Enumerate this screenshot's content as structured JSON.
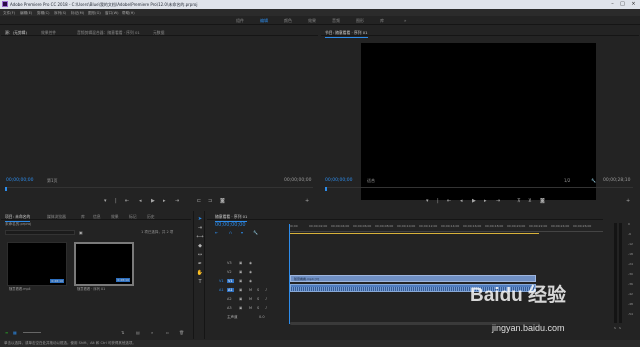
{
  "window": {
    "title": "Adobe Premiere Pro CC 2018 - C:\\Users\\Blue\\我的文档\\Adobe\\Premiere Pro\\12.0\\未命名的.prproj",
    "controls": [
      "–",
      "□",
      "×"
    ]
  },
  "menu": [
    "文件(F)",
    "编辑(E)",
    "剪辑(C)",
    "序列(S)",
    "标记(M)",
    "图形(G)",
    "窗口(W)",
    "帮助(H)"
  ],
  "workspaces": [
    {
      "label": "组件",
      "active": false
    },
    {
      "label": "编辑",
      "active": true
    },
    {
      "label": "颜色",
      "active": false
    },
    {
      "label": "效果",
      "active": false
    },
    {
      "label": "音频",
      "active": false
    },
    {
      "label": "图形",
      "active": false
    },
    {
      "label": "库",
      "active": false
    },
    {
      "label": "»",
      "active": false
    }
  ],
  "source_panel": {
    "tabs": [
      {
        "label": "源：(无剪辑)",
        "active": true
      },
      {
        "label": "效果控件",
        "active": false
      },
      {
        "label": "音频剪辑混合器：随意看看 · 序列 01",
        "active": false
      },
      {
        "label": "元数据",
        "active": false
      }
    ],
    "timecode_left": "00;00;00;00",
    "page": "第1页",
    "timecode_right": "00;00;00;00"
  },
  "program_panel": {
    "tab_label": "节目: 随意看看 · 序列 01",
    "timecode_left": "00;00;00;00",
    "fit": "适合",
    "ratio": "1/2",
    "timecode_right": "00;00;28;10"
  },
  "project_panel": {
    "tabs": [
      {
        "label": "项目: 未命名的",
        "active": true
      },
      {
        "label": "媒体浏览器",
        "active": false
      },
      {
        "label": "库",
        "active": false
      },
      {
        "label": "信息",
        "active": false
      },
      {
        "label": "效果",
        "active": false
      },
      {
        "label": "标记",
        "active": false
      },
      {
        "label": "历史",
        "active": false
      }
    ],
    "file_name": "未命名的.prproj",
    "search_placeholder": "",
    "selection_info": "1 项已选择，共 2 项",
    "items": [
      {
        "name": "随意看看.mp4",
        "duration": "0:28:10",
        "selected": false
      },
      {
        "name": "随意看看 · 序列 01",
        "duration": "0:28:10",
        "selected": true
      }
    ]
  },
  "timeline": {
    "tab_label": "随意看看 · 序列 01",
    "timecode": "00;00;00;00",
    "ruler_ticks": [
      "00;00",
      "00;00;02;00",
      "00;00;04;00",
      "00;00;06;00",
      "00;00;08;00",
      "00;00;10;00",
      "00;00;12;00",
      "00;00;14;00",
      "00;00;16;00",
      "00;00;18;00",
      "00;00;20;00",
      "00;00;22;00",
      "00;00;24;00",
      "00;00;26;00"
    ],
    "tracks": [
      {
        "name": "V3",
        "kind": "video"
      },
      {
        "name": "V2",
        "kind": "video"
      },
      {
        "name": "V1",
        "kind": "video"
      },
      {
        "name": "A1",
        "kind": "audio"
      },
      {
        "name": "A2",
        "kind": "audio"
      },
      {
        "name": "A3",
        "kind": "audio"
      }
    ],
    "master": {
      "label": "主声道",
      "value": "0.0"
    },
    "video_clip_label": "随意看看.mp4 [V]",
    "audio_clip_label": ""
  },
  "meters": {
    "scale": [
      "0",
      "-6",
      "-12",
      "-18",
      "-24",
      "-30",
      "-36",
      "-42",
      "-48",
      "-54"
    ],
    "footer": [
      "S",
      "S"
    ]
  },
  "status": {
    "text": "单击以选择，或单击空白处并拖动以框选。使用 Shift、Alt 和 Ctrl 可获得其他选项。"
  },
  "watermark": {
    "brand": "Baidu 经验",
    "url": "jingyan.baidu.com"
  },
  "colors": {
    "accent": "#2d8ceb",
    "video_clip": "#6f8fc3",
    "audio_clip": "#4f7cbf"
  }
}
